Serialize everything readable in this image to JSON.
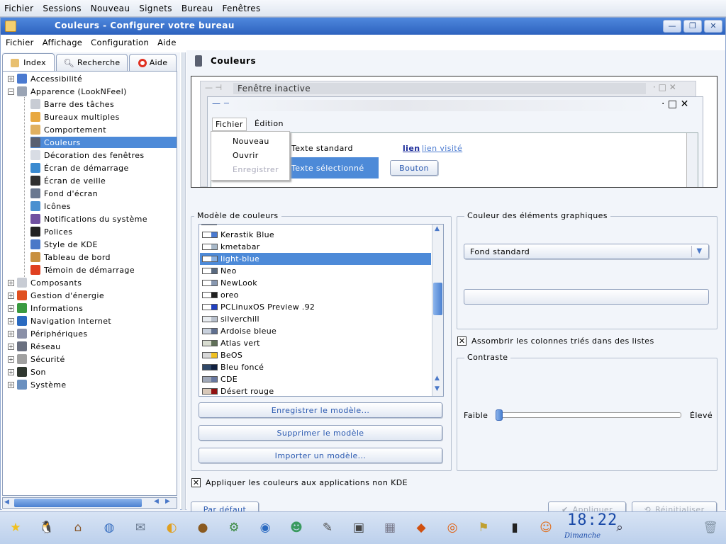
{
  "top_menu": [
    "Fichier",
    "Sessions",
    "Nouveau",
    "Signets",
    "Bureau",
    "Fenêtres"
  ],
  "window": {
    "title": "Couleurs - Configurer votre bureau",
    "menu": [
      "Fichier",
      "Affichage",
      "Configuration",
      "Aide"
    ],
    "title_buttons": {
      "minimize": "—",
      "maximize": "❐",
      "close": "✕"
    }
  },
  "sidebar": {
    "tabs": [
      {
        "label": "Index",
        "icon": "index-icon"
      },
      {
        "label": "Recherche",
        "icon": "search-icon"
      },
      {
        "label": "Aide",
        "icon": "help-icon"
      }
    ],
    "tree": [
      {
        "label": "Accessibilité",
        "level": 0,
        "expander": "+",
        "icon_color": "#4a7ad0"
      },
      {
        "label": "Apparence (LookNFeel)",
        "level": 0,
        "expander": "−",
        "icon_color": "#9aa4b4"
      },
      {
        "label": "Barre des tâches",
        "level": 1,
        "icon_color": "#c8ccd4"
      },
      {
        "label": "Bureaux multiples",
        "level": 1,
        "icon_color": "#e8a840"
      },
      {
        "label": "Comportement",
        "level": 1,
        "icon_color": "#e0b060"
      },
      {
        "label": "Couleurs",
        "level": 1,
        "selected": true,
        "icon_color": "#5a6070"
      },
      {
        "label": "Décoration des fenêtres",
        "level": 1,
        "icon_color": "#d8dce4"
      },
      {
        "label": "Écran de démarrage",
        "level": 1,
        "icon_color": "#3a8ad0"
      },
      {
        "label": "Écran de veille",
        "level": 1,
        "icon_color": "#303030"
      },
      {
        "label": "Fond d'écran",
        "level": 1,
        "icon_color": "#6a7890"
      },
      {
        "label": "Icônes",
        "level": 1,
        "icon_color": "#4a90d0"
      },
      {
        "label": "Notifications du système",
        "level": 1,
        "icon_color": "#7050a0"
      },
      {
        "label": "Polices",
        "level": 1,
        "icon_color": "#222222"
      },
      {
        "label": "Style de KDE",
        "level": 1,
        "icon_color": "#4a78c8"
      },
      {
        "label": "Tableau de bord",
        "level": 1,
        "icon_color": "#c89040"
      },
      {
        "label": "Témoin de démarrage",
        "level": 1,
        "icon_color": "#e04020"
      },
      {
        "label": "Composants",
        "level": 0,
        "expander": "+",
        "icon_color": "#c8ccd4"
      },
      {
        "label": "Gestion d'énergie",
        "level": 0,
        "expander": "+",
        "icon_color": "#e05020"
      },
      {
        "label": "Informations",
        "level": 0,
        "expander": "+",
        "icon_color": "#3a9a40"
      },
      {
        "label": "Navigation Internet",
        "level": 0,
        "expander": "+",
        "icon_color": "#2a6ac0"
      },
      {
        "label": "Périphériques",
        "level": 0,
        "expander": "+",
        "icon_color": "#8a90a8"
      },
      {
        "label": "Réseau",
        "level": 0,
        "expander": "+",
        "icon_color": "#6a7080"
      },
      {
        "label": "Sécurité",
        "level": 0,
        "expander": "+",
        "icon_color": "#a0a0a0"
      },
      {
        "label": "Son",
        "level": 0,
        "expander": "+",
        "icon_color": "#303830"
      },
      {
        "label": "Système",
        "level": 0,
        "expander": "+",
        "icon_color": "#6a90c0"
      }
    ]
  },
  "main": {
    "header": "Couleurs",
    "preview": {
      "inactive_title": "Fenêtre inactive",
      "menu": [
        "Fichier",
        "Édition"
      ],
      "dropdown": [
        "Nouveau",
        "Ouvrir",
        "Enregistrer"
      ],
      "standard_text": "Texte standard",
      "selected_text": "Texte sélectionné",
      "link": "lien",
      "visited_link": "lien visité",
      "button": "Bouton"
    },
    "schemes_group": {
      "title": "Modèle de couleurs",
      "items": [
        {
          "name": "Kerastik Blue",
          "colors": [
            "#ffffff",
            "#4a7ad0"
          ]
        },
        {
          "name": "kmetabar",
          "colors": [
            "#ffffff",
            "#a8b8c8"
          ]
        },
        {
          "name": "light-blue",
          "colors": [
            "#ffffff",
            "#8ab0e0"
          ],
          "selected": true
        },
        {
          "name": "Neo",
          "colors": [
            "#ffffff",
            "#5a6a80"
          ]
        },
        {
          "name": "NewLook",
          "colors": [
            "#ffffff",
            "#8898b0"
          ]
        },
        {
          "name": "oreo",
          "colors": [
            "#ffffff",
            "#202020"
          ]
        },
        {
          "name": "PCLinuxOS Preview .92",
          "colors": [
            "#ffffff",
            "#2040c0"
          ]
        },
        {
          "name": "silverchill",
          "colors": [
            "#e8ecf0",
            "#b8c0cc"
          ]
        },
        {
          "name": "Ardoise bleue",
          "colors": [
            "#c8d0dc",
            "#607090"
          ]
        },
        {
          "name": "Atlas vert",
          "colors": [
            "#d8dcd0",
            "#607058"
          ]
        },
        {
          "name": "BeOS",
          "colors": [
            "#d8d8d8",
            "#f0c020"
          ]
        },
        {
          "name": "Bleu foncé",
          "colors": [
            "#304868",
            "#102040"
          ]
        },
        {
          "name": "CDE",
          "colors": [
            "#a0a8b8",
            "#6878a0"
          ]
        },
        {
          "name": "Désert rouge",
          "colors": [
            "#d8c8b8",
            "#901010"
          ]
        }
      ],
      "buttons": [
        "Enregistrer le modèle...",
        "Supprimer le modèle",
        "Importer un modèle..."
      ]
    },
    "widget_color_group": {
      "title": "Couleur des éléments graphiques",
      "selected": "Fond standard"
    },
    "darken_sorted_columns": {
      "label": "Assombrir les colonnes triés dans des listes",
      "checked": true
    },
    "contrast_group": {
      "title": "Contraste",
      "low": "Faible",
      "high": "Élevé",
      "value": 0.0
    },
    "apply_non_kde": {
      "label": "Appliquer les couleurs aux applications non KDE",
      "checked": true
    },
    "footer": {
      "default": "Par défaut",
      "apply": "Appliquer",
      "reset": "Réinitialiser"
    }
  },
  "taskbar": {
    "clock_time": "18:22",
    "clock_day": "Dimanche",
    "launchers": [
      "star-icon",
      "tux-icon",
      "home-icon",
      "globe-icon",
      "mail-icon",
      "lock-icon",
      "bear-icon",
      "settings-icon",
      "earth-icon",
      "users-icon",
      "gimp-icon",
      "camera-icon",
      "calendar-icon",
      "car-icon",
      "firefox-icon",
      "flag-icon",
      "terminal-icon",
      "people-icon",
      "search-icon",
      "trash-icon"
    ]
  }
}
